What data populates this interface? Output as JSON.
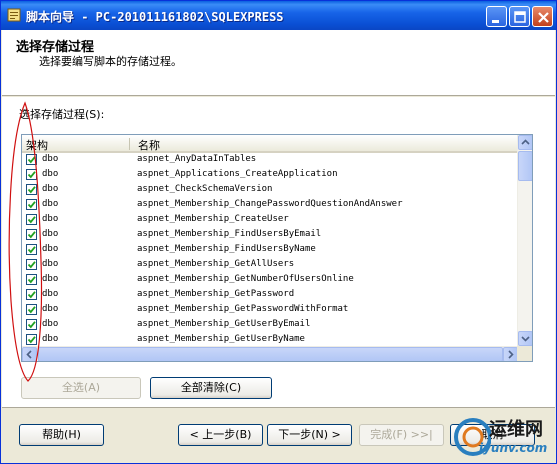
{
  "window": {
    "title": "脚本向导 - PC-201011161802\\SQLEXPRESS"
  },
  "header": {
    "title": "选择存储过程",
    "subtitle": "选择要编写脚本的存储过程。"
  },
  "list": {
    "label": "选择存储过程(S):",
    "columns": [
      "架构",
      "名称"
    ],
    "rows": [
      {
        "checked": true,
        "schema": "dbo",
        "name": "aspnet_AnyDataInTables"
      },
      {
        "checked": true,
        "schema": "dbo",
        "name": "aspnet_Applications_CreateApplication"
      },
      {
        "checked": true,
        "schema": "dbo",
        "name": "aspnet_CheckSchemaVersion"
      },
      {
        "checked": true,
        "schema": "dbo",
        "name": "aspnet_Membership_ChangePasswordQuestionAndAnswer"
      },
      {
        "checked": true,
        "schema": "dbo",
        "name": "aspnet_Membership_CreateUser"
      },
      {
        "checked": true,
        "schema": "dbo",
        "name": "aspnet_Membership_FindUsersByEmail"
      },
      {
        "checked": true,
        "schema": "dbo",
        "name": "aspnet_Membership_FindUsersByName"
      },
      {
        "checked": true,
        "schema": "dbo",
        "name": "aspnet_Membership_GetAllUsers"
      },
      {
        "checked": true,
        "schema": "dbo",
        "name": "aspnet_Membership_GetNumberOfUsersOnline"
      },
      {
        "checked": true,
        "schema": "dbo",
        "name": "aspnet_Membership_GetPassword"
      },
      {
        "checked": true,
        "schema": "dbo",
        "name": "aspnet_Membership_GetPasswordWithFormat"
      },
      {
        "checked": true,
        "schema": "dbo",
        "name": "aspnet_Membership_GetUserByEmail"
      },
      {
        "checked": true,
        "schema": "dbo",
        "name": "aspnet_Membership_GetUserByName"
      }
    ]
  },
  "buttons": {
    "select_all": "全选(A)",
    "clear_all": "全部清除(C)",
    "help": "帮助(H)",
    "back": "< 上一步(B)",
    "next": "下一步(N) >",
    "finish": "完成(F) >>|",
    "cancel": "取消"
  },
  "watermark": {
    "line1": "运维网",
    "line2": "iyunv.com"
  },
  "colors": {
    "titlebar": "#0a5fe0",
    "check": "#21a121",
    "annotation": "#d01010"
  }
}
